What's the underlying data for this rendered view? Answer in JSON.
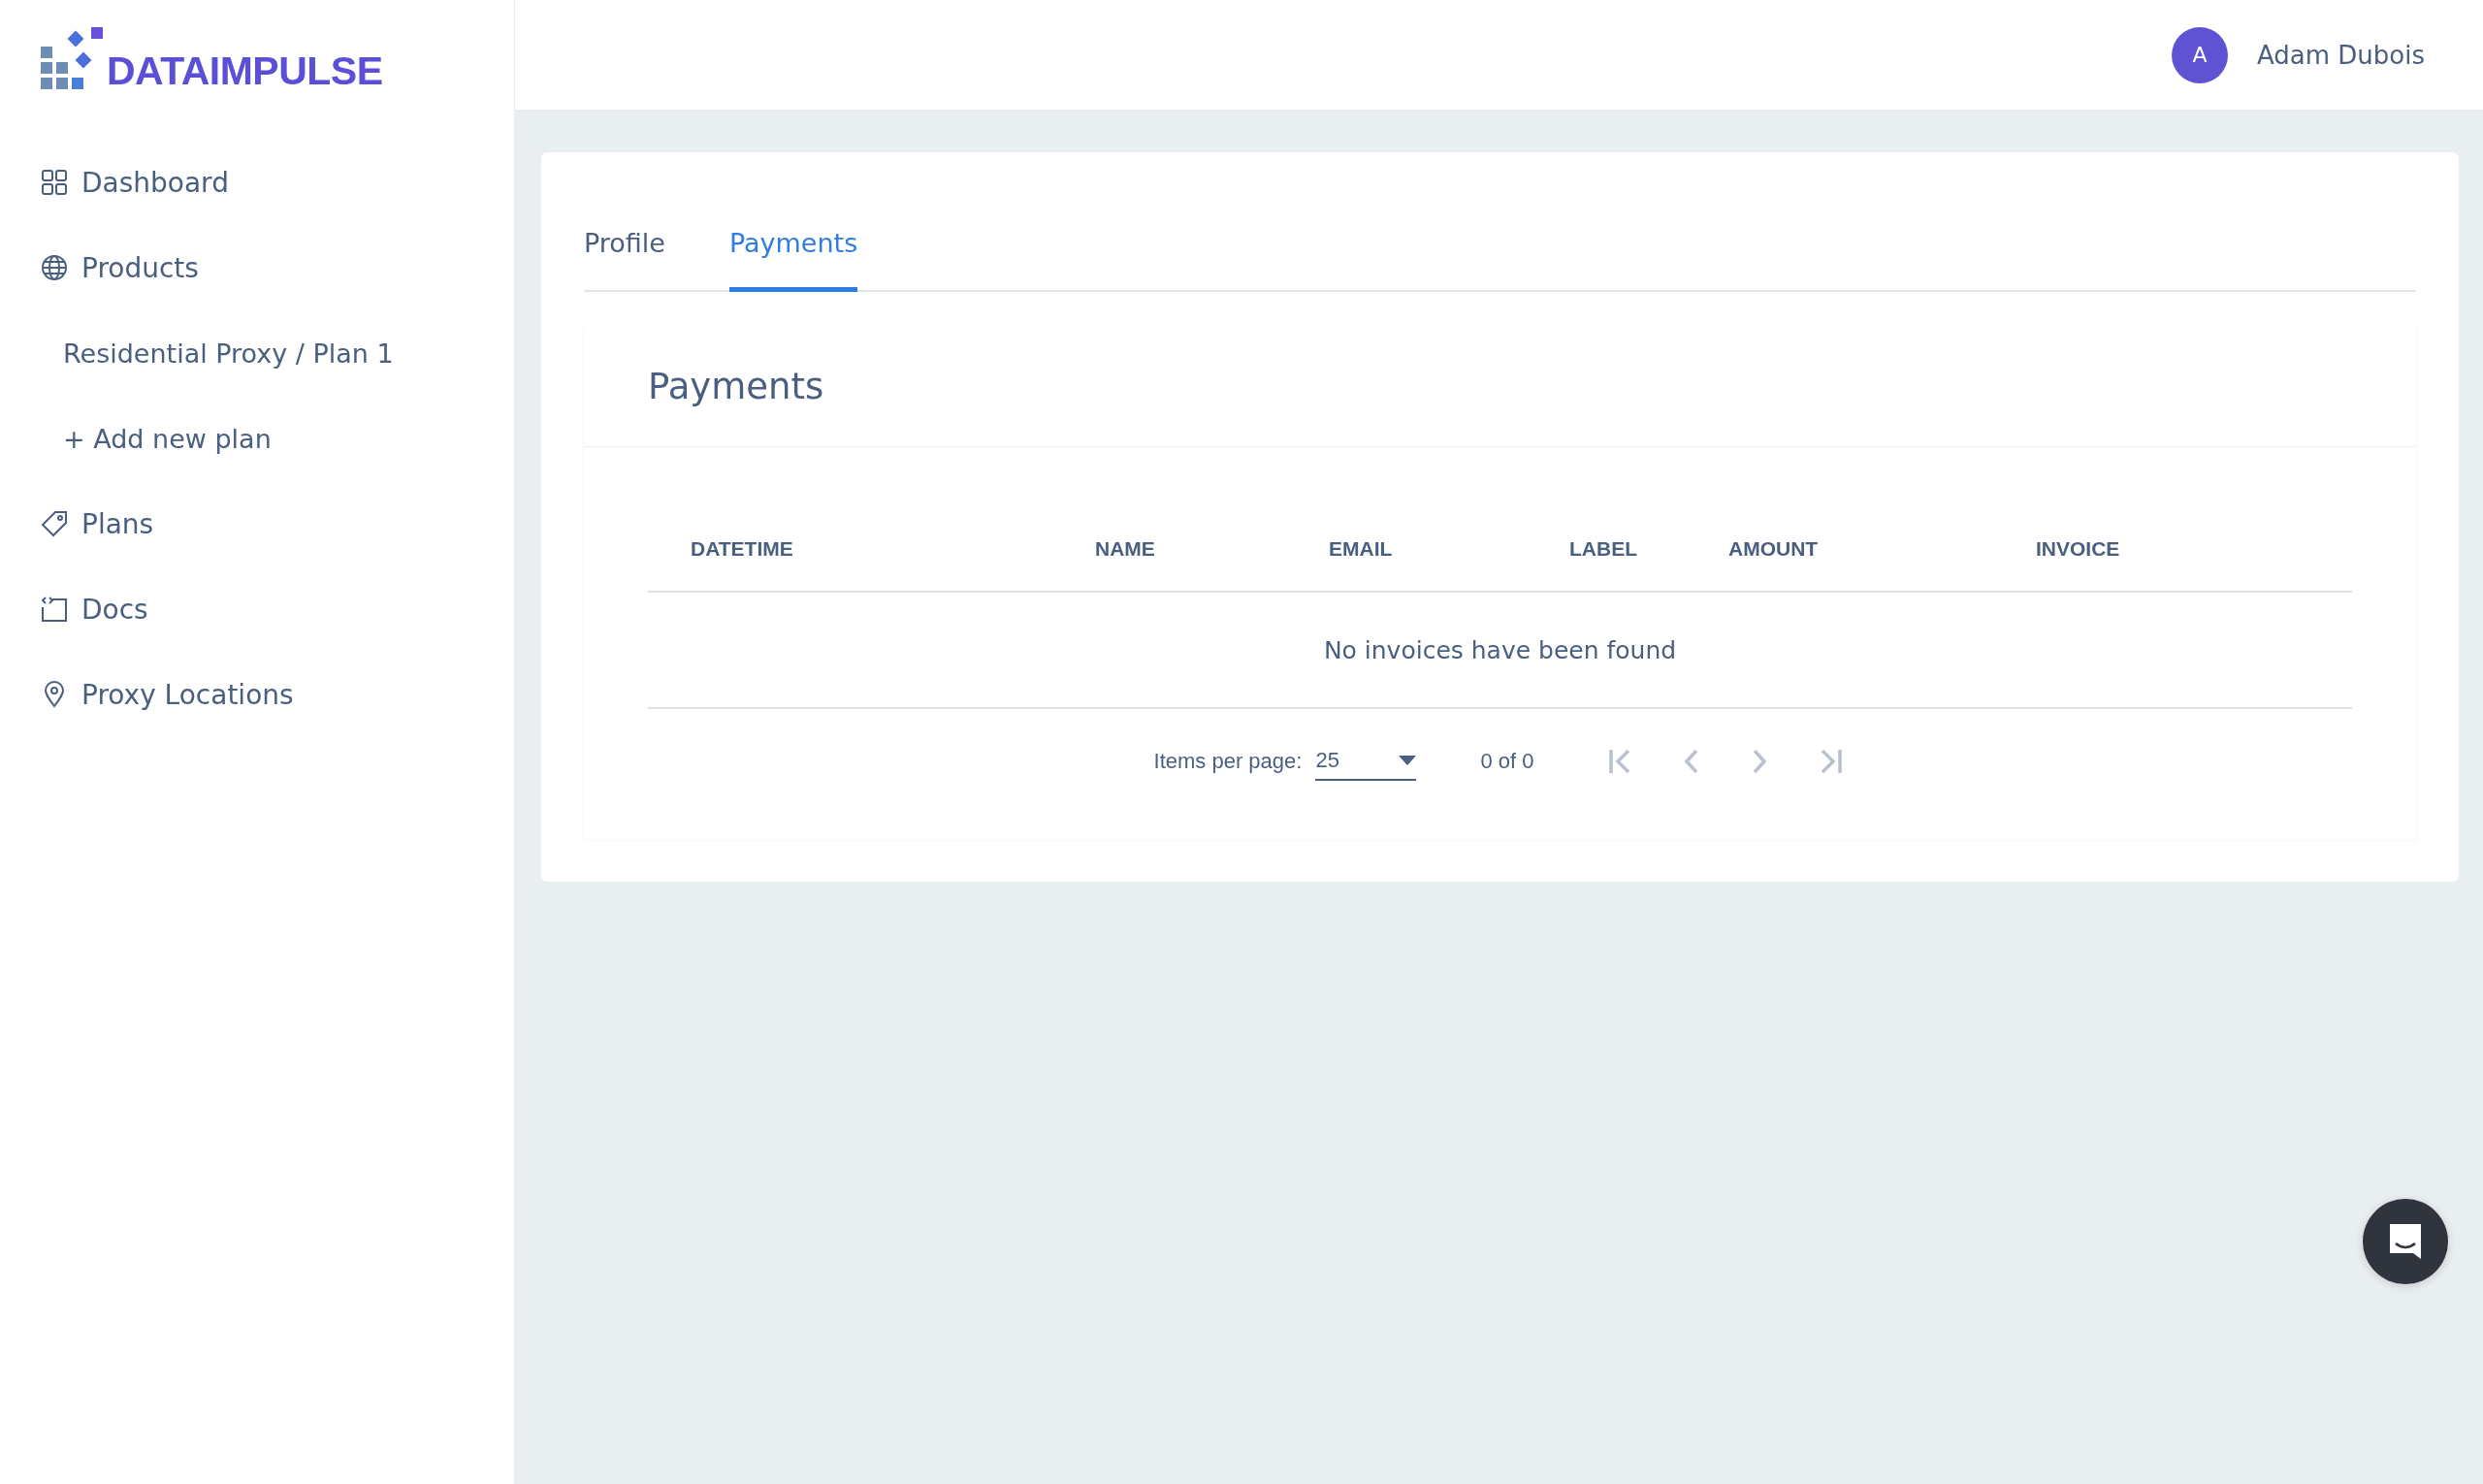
{
  "logo": {
    "text": "DATAIMPULSE"
  },
  "sidebar": {
    "items": [
      {
        "label": "Dashboard",
        "kind": "nav"
      },
      {
        "label": "Products",
        "kind": "nav"
      },
      {
        "label": "Residential Proxy / Plan 1",
        "kind": "sub"
      },
      {
        "label": "+ Add new plan",
        "kind": "sub"
      },
      {
        "label": "Plans",
        "kind": "nav"
      },
      {
        "label": "Docs",
        "kind": "nav"
      },
      {
        "label": "Proxy Locations",
        "kind": "nav"
      }
    ]
  },
  "header": {
    "avatar_initial": "A",
    "user_name": "Adam Dubois"
  },
  "tabs": [
    {
      "label": "Profile",
      "selected": false
    },
    {
      "label": "Payments",
      "selected": true
    }
  ],
  "payments": {
    "title": "Payments",
    "table": {
      "columns": [
        "DATETIME",
        "NAME",
        "EMAIL",
        "LABEL",
        "AMOUNT",
        "INVOICE"
      ],
      "empty_message": "No invoices have been found"
    },
    "pagination": {
      "items_per_page_label": "Items per page:",
      "page_size": "25",
      "range": "0 of 0",
      "buttons": [
        {
          "kind": "first",
          "disabled": true
        },
        {
          "kind": "prev",
          "disabled": true
        },
        {
          "kind": "next",
          "disabled": true
        },
        {
          "kind": "last",
          "disabled": true
        }
      ]
    }
  }
}
